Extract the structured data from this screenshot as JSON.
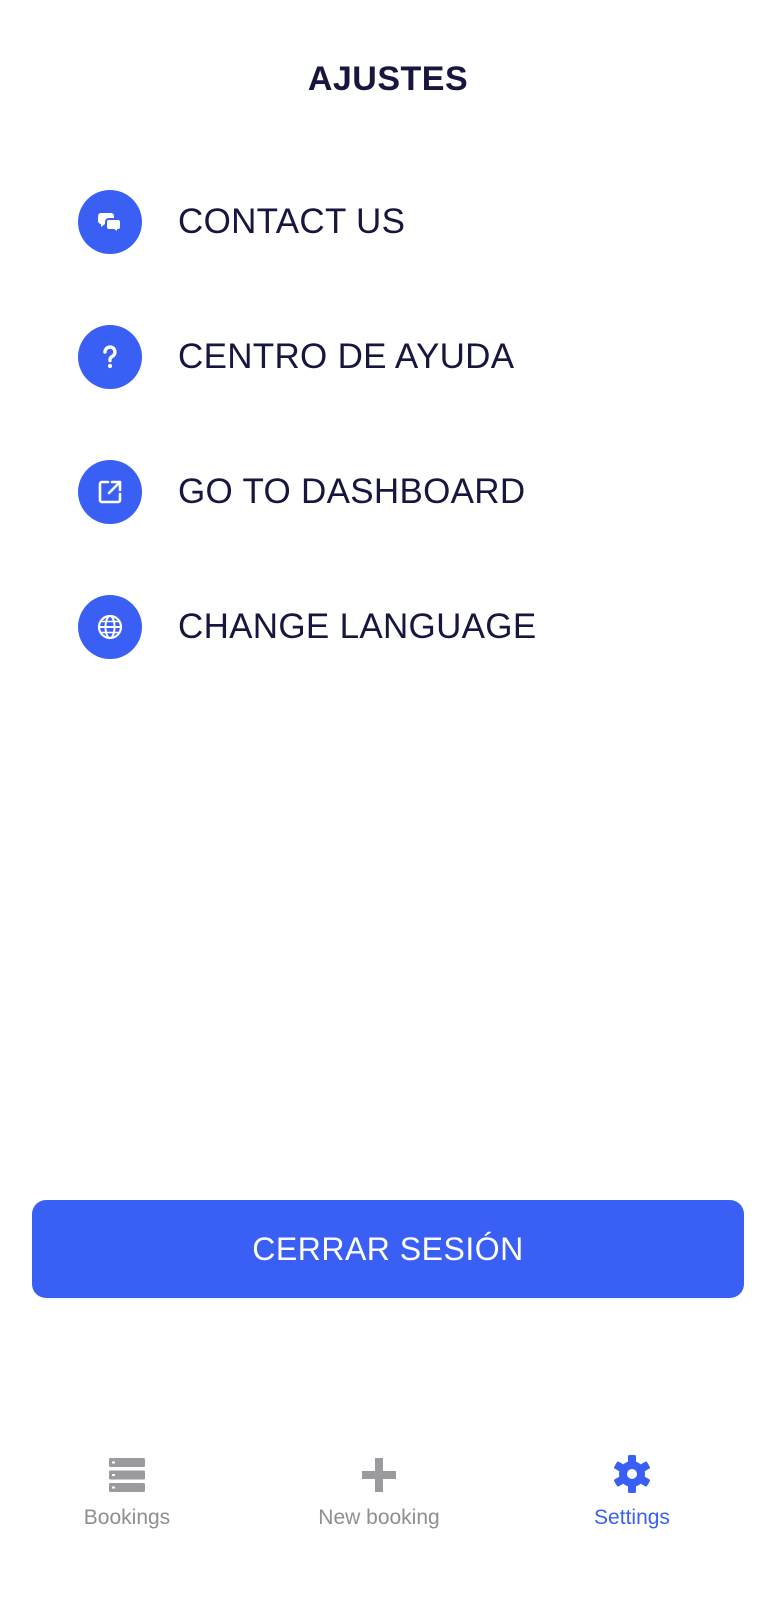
{
  "header": {
    "title": "AJUSTES"
  },
  "menu": {
    "items": [
      {
        "label": "CONTACT US",
        "icon": "chat-bubbles-icon"
      },
      {
        "label": "CENTRO DE AYUDA",
        "icon": "question-icon"
      },
      {
        "label": "GO TO DASHBOARD",
        "icon": "external-link-icon"
      },
      {
        "label": "CHANGE LANGUAGE",
        "icon": "globe-icon"
      }
    ]
  },
  "logout": {
    "label": "CERRAR SESIÓN"
  },
  "tabbar": {
    "tabs": [
      {
        "label": "Bookings",
        "icon": "list-icon",
        "active": false
      },
      {
        "label": "New booking",
        "icon": "plus-icon",
        "active": false
      },
      {
        "label": "Settings",
        "icon": "gear-icon",
        "active": true
      }
    ]
  },
  "colors": {
    "accent": "#3a5ff5",
    "text": "#16163f",
    "inactive_tab": "#8e8e93",
    "background": "#ffffff"
  }
}
